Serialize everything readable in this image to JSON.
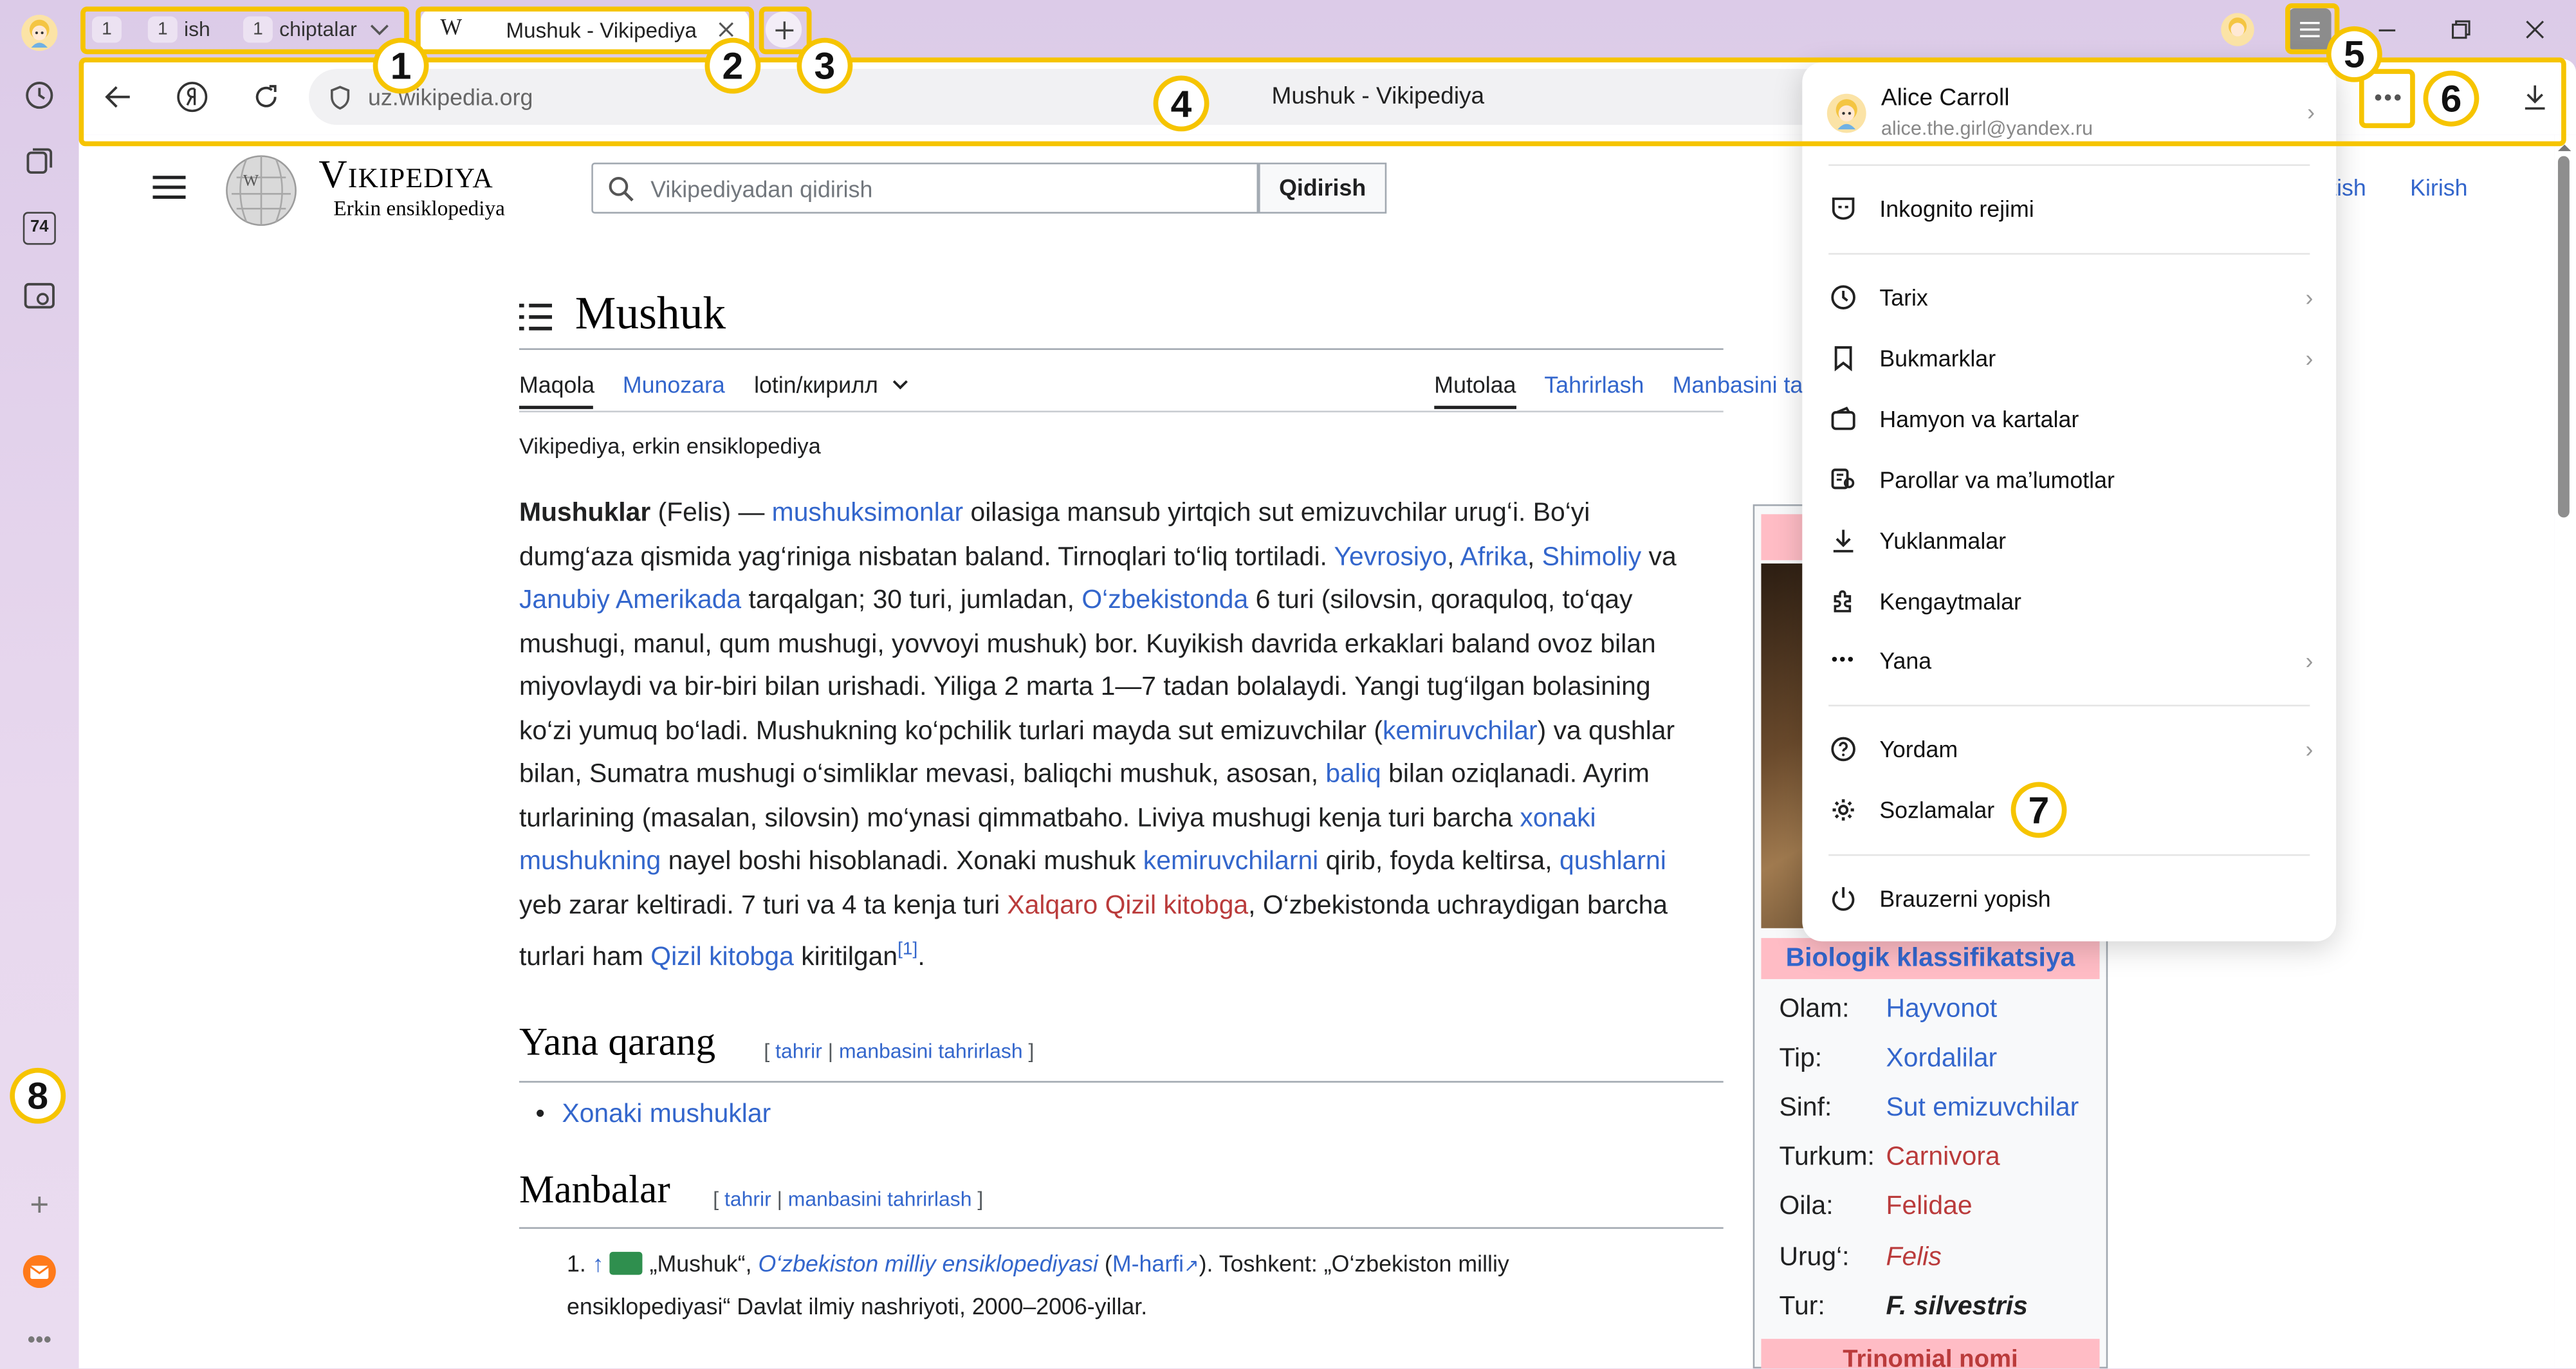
{
  "browser": {
    "tab_groups": [
      {
        "count": "1",
        "label": ""
      },
      {
        "count": "1",
        "label": "ish"
      },
      {
        "count": "1",
        "label": "chiptalar"
      }
    ],
    "active_tab": {
      "title": "Mushuk - Vikipediya",
      "favicon": "W"
    },
    "new_tab_icon": "plus-icon",
    "address": "uz.wikipedia.org",
    "page_title": "Mushuk - Vikipediya",
    "sidebar_badge": "74"
  },
  "menu": {
    "user_name": "Alice Carroll",
    "user_email": "alice.the.girl@yandex.ru",
    "items": [
      {
        "label": "Inkognito rejimi",
        "icon": "incognito-icon"
      },
      {
        "label": "Tarix",
        "icon": "history-icon"
      },
      {
        "label": "Bukmarklar",
        "icon": "bookmark-icon"
      },
      {
        "label": "Hamyon va kartalar",
        "icon": "wallet-icon"
      },
      {
        "label": "Parollar va ma’lumotlar",
        "icon": "key-icon"
      },
      {
        "label": "Yuklanmalar",
        "icon": "download-icon"
      },
      {
        "label": "Kengaytmalar",
        "icon": "extensions-icon"
      },
      {
        "label": "Yana",
        "icon": "more-icon"
      },
      {
        "label": "Yordam",
        "icon": "help-icon"
      },
      {
        "label": "Sozlamalar",
        "icon": "settings-icon"
      },
      {
        "label": "Brauzerni yopish",
        "icon": "power-icon"
      }
    ]
  },
  "annotations": [
    "1",
    "2",
    "3",
    "4",
    "5",
    "6",
    "7",
    "8"
  ],
  "wiki": {
    "logo_title": "Vikipediya",
    "logo_subtitle": "Erkin ensiklopediya",
    "search_placeholder": "Vikipediyadan qidirish",
    "search_button": "Qidirish",
    "header_links": {
      "register": "ratish",
      "login": "Kirish"
    },
    "article_title": "Mushuk",
    "tabs_left": [
      "Maqola",
      "Munozara",
      "lotin/кирилл"
    ],
    "tabs_right": [
      "Mutolaa",
      "Tahrirlash",
      "Manbasini ta"
    ],
    "tagline": "Vikipediya, erkin ensiklopediya",
    "para": {
      "t1": "Mushuklar",
      "t2": " (Felis) — ",
      "l1": "mushuksimonlar",
      "t3": " oilasiga mansub yirtqich sut emizuvchilar urug‘i. Bo‘yi dumg‘aza qismida yag‘riniga nisbatan baland. Tirnoqlari to‘liq tortiladi. ",
      "l2": "Yevrosiyo",
      "c1": ", ",
      "l3": "Afrika",
      "c2": ", ",
      "l4": "Shimoliy",
      "t4": " va ",
      "l5": "Janubiy Amerikada",
      "t5": " tarqalgan; 30 turi, jumladan, ",
      "l6": "O‘zbekistonda",
      "t6": " 6 turi (silovsin, qoraquloq, to‘qay mushugi, manul, qum mushugi, yovvoyi mushuk) bor. Kuyikish davrida erkaklari baland ovoz bilan miyovlaydi va bir-biri bilan urishadi. Yiliga 2 marta 1—7 tadan bolalaydi. Yangi tug‘ilgan bolasining ko‘zi yumuq bo‘ladi. Mushukning ko‘pchilik turlari mayda sut emizuvchilar (",
      "l7": "kemiruvchilar",
      "t7": ") va qushlar bilan, Sumatra mushugi o‘simliklar mevasi, baliqchi mushuk, asosan, ",
      "l8": "baliq",
      "t8": " bilan oziqlanadi. Ayrim turlarining (masalan, silovsin) mo‘ynasi qimmatbaho. Liviya mushugi kenja turi barcha ",
      "l9": "xonaki mushukning",
      "t9": " nayel boshi hisoblanadi. Xonaki mushuk ",
      "l10": "kemiruvchilarni",
      "t10": " qirib, foyda keltirsa, ",
      "l11": "qushlarni",
      "t11": " yeb zarar keltiradi. 7 turi va 4 ta kenja turi ",
      "l12": "Xalqaro Qizil kitobga",
      "t12": ", O‘zbekistonda uchraydigan barcha turlari ham ",
      "l13": "Qizil kitobga",
      "t13": " kiritilgan",
      "ref": "[1]",
      "t14": "."
    },
    "see_also": {
      "heading": "Yana qarang",
      "edit_open": "[ ",
      "edit": "tahrir",
      "edit_sep": " | ",
      "edit_src": "manbasini tahrirlash",
      "edit_close": " ]",
      "items": [
        "Xonaki mushuklar"
      ]
    },
    "sources": {
      "heading": "Manbalar",
      "edit_open": "[ ",
      "edit": "tahrir",
      "edit_sep": " | ",
      "edit_src": "manbasini tahrirlash",
      "edit_close": " ]",
      "ref": {
        "num": "1.",
        "arrow": "↑",
        "q1": " „Mushuk“, ",
        "work": "O‘zbekiston milliy ensiklopediyasi",
        "p1": " (",
        "m": "M-harfi",
        "p2": "). Toshkent: „O‘zbekiston milliy ensiklopediyasi“ Davlat ilmiy nashriyoti, 2000–2006-yillar."
      }
    },
    "infobox": {
      "heading": "Biologik klassifikatsiya",
      "rows": [
        {
          "k": "Olam:",
          "v": "Hayvonot"
        },
        {
          "k": "Tip:",
          "v": "Xordalilar"
        },
        {
          "k": "Sinf:",
          "v": "Sut emizuvchilar"
        },
        {
          "k": "Turkum:",
          "v": "Carnivora"
        },
        {
          "k": "Oila:",
          "v": "Felidae"
        },
        {
          "k": "Urug‘:",
          "v": "Felis"
        },
        {
          "k": "Tur:",
          "v": "F. silvestris"
        }
      ],
      "footer": "Trinomial nomi"
    }
  }
}
